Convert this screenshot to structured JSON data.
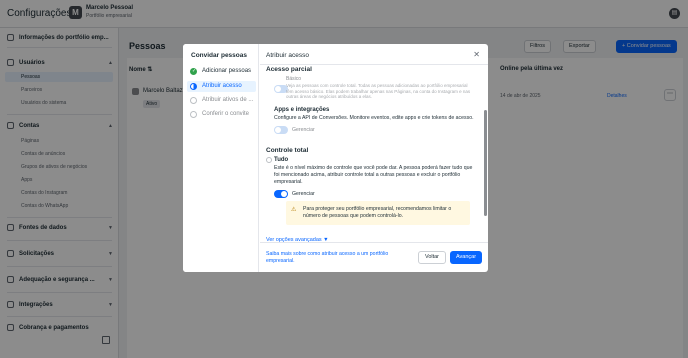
{
  "app": {
    "title": "Configurações",
    "account_initial": "M",
    "account_name": "Marcelo Pessoal",
    "account_subtitle": "Portfólio empresarial"
  },
  "sidebar": {
    "portfolio_info": "Informações do portfólio emp...",
    "users_section": "Usuários",
    "users_items": [
      "Pessoas",
      "Parceiros",
      "Usuários do sistema"
    ],
    "accounts_section": "Contas",
    "accounts_items": [
      "Páginas",
      "Contas de anúncios",
      "Grupos de ativos de negócios",
      "Apps",
      "Contas do Instagram",
      "Contas do WhatsApp"
    ],
    "data_sources": "Fontes de dados",
    "requests": "Solicitações",
    "brand_safety": "Adequação e segurança ...",
    "integrations": "Integrações",
    "billing": "Cobrança e pagamentos"
  },
  "main": {
    "page_title": "Pessoas",
    "filters_label": "Filtros",
    "export_label": "Exportar",
    "invite_label": "+ Convidar pessoas",
    "col_name": "Nome ⇅",
    "col_online": "Online pela última vez",
    "row": {
      "name": "Marcelo Baltaz...",
      "badge": "Ativo",
      "last_online": "14 de abr de 2025",
      "details_link": "Detalhes"
    }
  },
  "modal": {
    "steps_title": "Convidar pessoas",
    "steps": [
      "Adicionar pessoas",
      "Atribuir acesso",
      "Atribuir ativos de ...",
      "Conferir o convite"
    ],
    "panel_title": "Atribuir acesso",
    "partial_access": {
      "heading": "Acesso parcial",
      "basic_title": "Básico",
      "basic_desc": "Veja as pessoas com controle total. Todas as pessoas adicionadas ao portfólio empresarial têm acesso básico. Elas podem trabalhar apenas nas Páginas, na conta do Instagram e nas outras áreas de negócios atribuídos a elas.",
      "apps_title": "Apps e integrações",
      "apps_desc": "Configure a API de Conversões. Monitore eventos, edite apps e crie tokens de acesso.",
      "manage_label": "Gerenciar"
    },
    "full_control": {
      "heading": "Controle total",
      "all_title": "Tudo",
      "all_desc": "Este é o nível máximo de controle que você pode dar. A pessoa poderá fazer tudo que foi mencionado acima, atribuir controle total a outras pessoas e excluir o portfólio empresarial.",
      "manage_label": "Gerenciar",
      "warning": "Para proteger seu portfólio empresarial, recomendamos limitar o número de pessoas que podem controlá-lo."
    },
    "advanced_link": "Ver opções avançadas ▼",
    "help_link": "Saiba mais sobre como atribuir acesso a um portfólio empresarial.",
    "back_label": "Voltar",
    "next_label": "Avançar"
  }
}
